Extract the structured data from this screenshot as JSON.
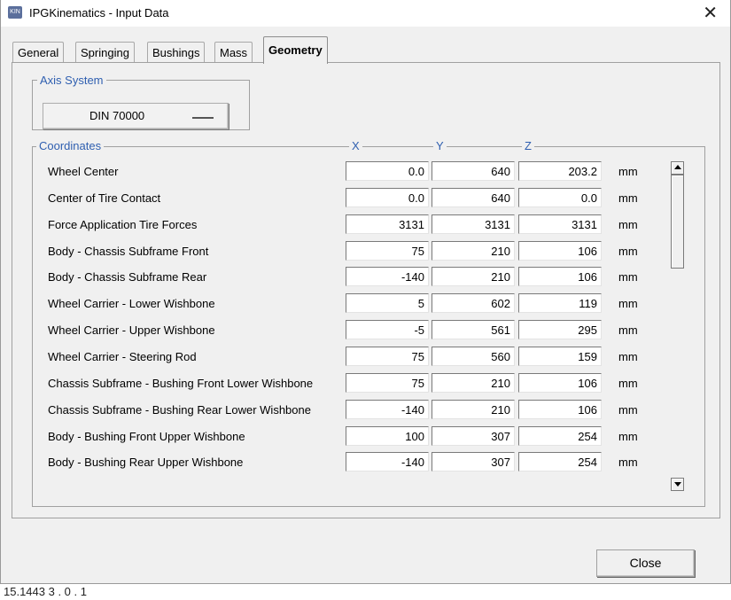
{
  "window": {
    "title": "IPGKinematics - Input Data",
    "icon_text": "KIN"
  },
  "tabs": [
    {
      "label": "General",
      "active": false
    },
    {
      "label": "Springing",
      "active": false
    },
    {
      "label": "Bushings",
      "active": false
    },
    {
      "label": "Mass",
      "active": false
    },
    {
      "label": "Geometry",
      "active": true
    }
  ],
  "axis_system": {
    "legend": "Axis System",
    "value": "DIN 70000"
  },
  "coordinates": {
    "legend": "Coordinates",
    "columns": [
      "X",
      "Y",
      "Z"
    ],
    "rows": [
      {
        "label": "Wheel Center",
        "x": "0.0",
        "y": "640",
        "z": "203.2",
        "unit": "mm"
      },
      {
        "label": "Center of Tire Contact",
        "x": "0.0",
        "y": "640",
        "z": "0.0",
        "unit": "mm"
      },
      {
        "label": "Force Application Tire Forces",
        "x": "3131",
        "y": "3131",
        "z": "3131",
        "unit": "mm"
      },
      {
        "label": "Body - Chassis Subframe Front",
        "x": "75",
        "y": "210",
        "z": "106",
        "unit": "mm"
      },
      {
        "label": "Body - Chassis Subframe Rear",
        "x": "-140",
        "y": "210",
        "z": "106",
        "unit": "mm"
      },
      {
        "label": "Wheel Carrier - Lower Wishbone",
        "x": "5",
        "y": "602",
        "z": "119",
        "unit": "mm"
      },
      {
        "label": "Wheel Carrier - Upper Wishbone",
        "x": "-5",
        "y": "561",
        "z": "295",
        "unit": "mm"
      },
      {
        "label": "Wheel Carrier - Steering Rod",
        "x": "75",
        "y": "560",
        "z": "159",
        "unit": "mm"
      },
      {
        "label": "Chassis Subframe - Bushing Front Lower Wishbone",
        "x": "75",
        "y": "210",
        "z": "106",
        "unit": "mm"
      },
      {
        "label": "Chassis Subframe - Bushing Rear Lower Wishbone",
        "x": "-140",
        "y": "210",
        "z": "106",
        "unit": "mm"
      },
      {
        "label": "Body - Bushing Front Upper Wishbone",
        "x": "100",
        "y": "307",
        "z": "254",
        "unit": "mm"
      },
      {
        "label": "Body - Bushing Rear Upper Wishbone",
        "x": "-140",
        "y": "307",
        "z": "254",
        "unit": "mm"
      }
    ]
  },
  "buttons": {
    "close": "Close"
  },
  "bottom_text": "15.1443 3 . 0 . 1"
}
